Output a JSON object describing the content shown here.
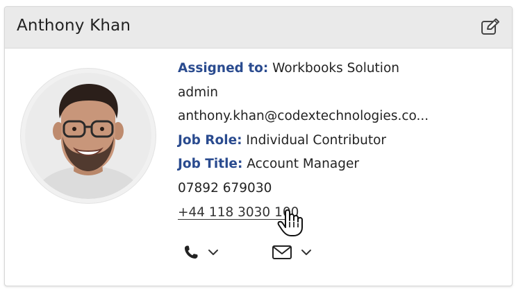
{
  "contact": {
    "name": "Anthony Khan",
    "assigned_to_label": "Assigned to:",
    "assigned_to_value": "Workbooks Solution",
    "assigned_to_user": "admin",
    "email": "anthony.khan@codextechnologies.co...",
    "job_role_label": "Job Role:",
    "job_role_value": "Individual Contributor",
    "job_title_label": "Job Title:",
    "job_title_value": "Account Manager",
    "phone_mobile": "07892 679030",
    "phone_office": "+44 118 3030 100"
  },
  "actions": {
    "call_icon": "phone-icon",
    "email_icon": "envelope-icon",
    "dropdown_icon": "chevron-down-icon"
  },
  "header": {
    "edit_icon": "edit-icon"
  },
  "colors": {
    "label": "#2a4b8f",
    "header_bg": "#eaeaea",
    "text": "#222222"
  }
}
